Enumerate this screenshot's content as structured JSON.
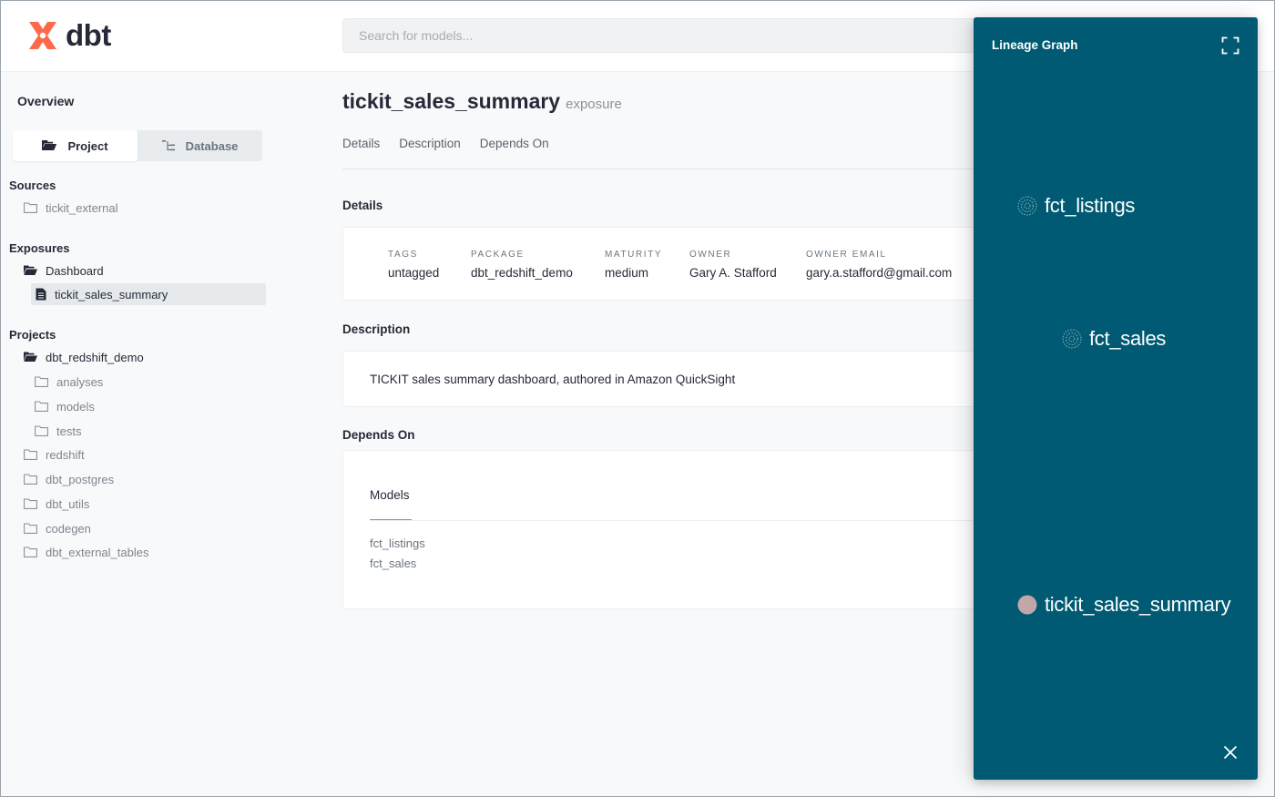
{
  "header": {
    "logo_text": "dbt",
    "search_placeholder": "Search for models..."
  },
  "sidebar": {
    "overview": "Overview",
    "switch": {
      "project": "Project",
      "database": "Database",
      "active": "Project"
    },
    "sources": {
      "title": "Sources",
      "items": [
        "tickit_external"
      ]
    },
    "exposures": {
      "title": "Exposures",
      "group": "Dashboard",
      "items": [
        "tickit_sales_summary"
      ]
    },
    "projects": {
      "title": "Projects",
      "root": "dbt_redshift_demo",
      "root_children": [
        "analyses",
        "models",
        "tests"
      ],
      "packages": [
        "redshift",
        "dbt_postgres",
        "dbt_utils",
        "codegen",
        "dbt_external_tables"
      ]
    }
  },
  "main": {
    "title": "tickit_sales_summary",
    "resource_type": "exposure",
    "tabs": [
      "Details",
      "Description",
      "Depends On"
    ],
    "details": {
      "heading": "Details",
      "fields": [
        {
          "label": "TAGS",
          "value": "untagged"
        },
        {
          "label": "PACKAGE",
          "value": "dbt_redshift_demo"
        },
        {
          "label": "MATURITY",
          "value": "medium"
        },
        {
          "label": "OWNER",
          "value": "Gary A. Stafford"
        },
        {
          "label": "OWNER EMAIL",
          "value": "gary.a.stafford@gmail.com"
        }
      ]
    },
    "description": {
      "heading": "Description",
      "text": "TICKIT sales summary dashboard, authored in Amazon QuickSight"
    },
    "depends_on": {
      "heading": "Depends On",
      "models_heading": "Models",
      "models": [
        "fct_listings",
        "fct_sales"
      ]
    }
  },
  "lineage": {
    "title": "Lineage Graph",
    "nodes": [
      {
        "label": "fct_listings",
        "kind": "model",
        "color": "#7fa6b3"
      },
      {
        "label": "fct_sales",
        "kind": "model",
        "color": "#7fa6b3"
      },
      {
        "label": "tickit_sales_summary",
        "kind": "exposure",
        "color": "#c3a6a7"
      }
    ],
    "icons": {
      "expand": "expand-icon",
      "close": "close-icon"
    }
  },
  "colors": {
    "brand": "#ff694b",
    "lineage_bg": "#005a73",
    "text": "#262a38",
    "muted": "#7d8690"
  }
}
